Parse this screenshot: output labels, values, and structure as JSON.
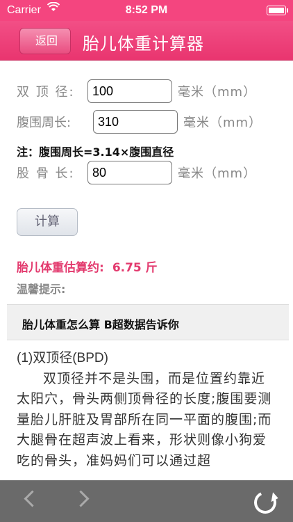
{
  "status_bar": {
    "carrier": "Carrier",
    "time": "8:52 PM"
  },
  "nav": {
    "back_label": "返回",
    "title": "胎儿体重计算器"
  },
  "form": {
    "bpd": {
      "label": "双 顶 径:",
      "value": "100",
      "unit": "毫米（mm）"
    },
    "ac": {
      "label": "腹围周长:",
      "value": "310",
      "unit": "毫米（mm）"
    },
    "note": "注：腹围周长=3.14×腹围直径",
    "fl": {
      "label": "股 骨 长:",
      "value": "80",
      "unit": "毫米（mm）"
    },
    "calc_label": "计算"
  },
  "result": {
    "label": "胎儿体重估算约:",
    "value": "6.75 斤"
  },
  "tip": "温馨提示:",
  "article": {
    "header": "胎儿体重怎么算 B超数据告诉你",
    "subtitle": "(1)双顶径(BPD)",
    "body": "双顶径并不是头围，而是位置约靠近太阳穴，骨头两侧顶骨径的长度;腹围要测量胎儿肝脏及胃部所在同一平面的腹围;而大腿骨在超声波上看来，形状则像小狗爱吃的骨头，准妈妈们可以通过超"
  },
  "toolbar": {
    "back_icon": "chevron-left-icon",
    "forward_icon": "chevron-right-icon",
    "refresh_icon": "refresh-icon"
  },
  "colors": {
    "brand": "#f4457f",
    "result": "#e33a6e"
  }
}
